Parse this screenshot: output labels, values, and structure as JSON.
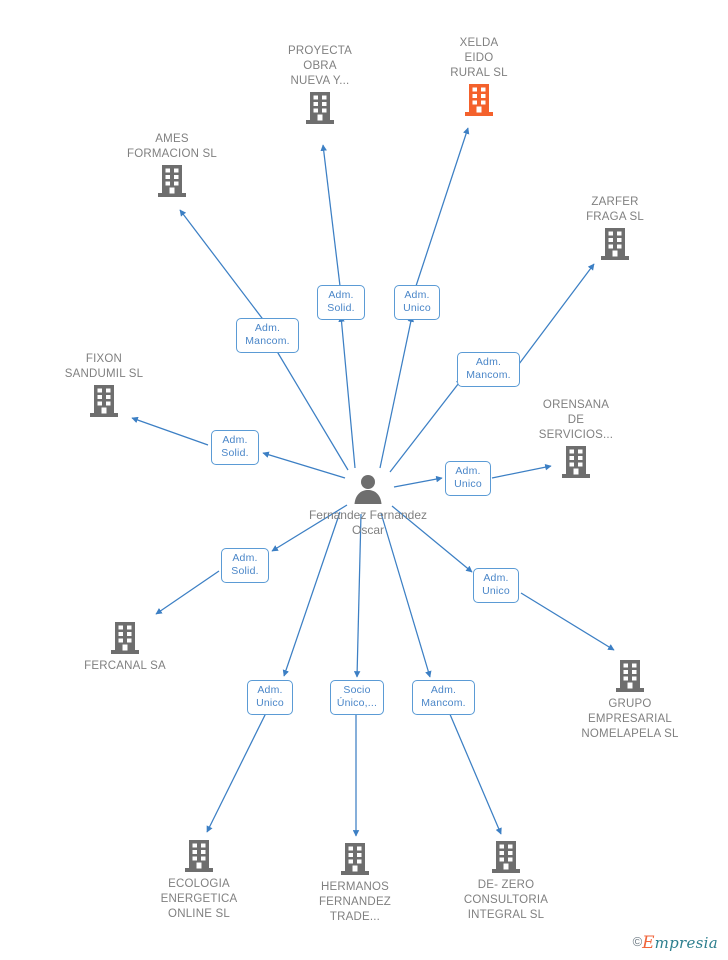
{
  "graph": {
    "center": {
      "name": "Fernandez Fernandez Oscar",
      "icon": "person-icon",
      "color": "#6e6e6e"
    },
    "nodes": [
      {
        "id": "proyecta",
        "label": "PROYECTA\nOBRA\nNUEVA Y...",
        "icon": "building-icon",
        "color": "#6e6e6e",
        "highlighted": false
      },
      {
        "id": "xelda",
        "label": "XELDA\nEIDO\nRURAL SL",
        "icon": "building-icon",
        "color": "#f4612c",
        "highlighted": true
      },
      {
        "id": "ames",
        "label": "AMES\nFORMACION SL",
        "icon": "building-icon",
        "color": "#6e6e6e",
        "highlighted": false
      },
      {
        "id": "zarfer",
        "label": "ZARFER\nFRAGA SL",
        "icon": "building-icon",
        "color": "#6e6e6e",
        "highlighted": false
      },
      {
        "id": "fixon",
        "label": "FIXON\nSANDUMIL SL",
        "icon": "building-icon",
        "color": "#6e6e6e",
        "highlighted": false
      },
      {
        "id": "orensana",
        "label": "ORENSANA\nDE\nSERVICIOS...",
        "icon": "building-icon",
        "color": "#6e6e6e",
        "highlighted": false
      },
      {
        "id": "fercanal",
        "label": "FERCANAL SA",
        "icon": "building-icon",
        "color": "#6e6e6e",
        "highlighted": false
      },
      {
        "id": "grupo",
        "label": "GRUPO\nEMPRESARIAL\nNOMELAPELA SL",
        "icon": "building-icon",
        "color": "#6e6e6e",
        "highlighted": false
      },
      {
        "id": "ecologia",
        "label": "ECOLOGIA\nENERGETICA\nONLINE SL",
        "icon": "building-icon",
        "color": "#6e6e6e",
        "highlighted": false
      },
      {
        "id": "hermanos",
        "label": "HERMANOS\nFERNANDEZ\nTRADE...",
        "icon": "building-icon",
        "color": "#6e6e6e",
        "highlighted": false
      },
      {
        "id": "dezero",
        "label": "DE- ZERO\nCONSULTORIA\nINTEGRAL SL",
        "icon": "building-icon",
        "color": "#6e6e6e",
        "highlighted": false
      }
    ],
    "edge_labels": [
      {
        "id": "e-ames",
        "text": "Adm.\nMancom.",
        "target": "ames"
      },
      {
        "id": "e-proyecta",
        "text": "Adm.\nSolid.",
        "target": "proyecta"
      },
      {
        "id": "e-xelda",
        "text": "Adm.\nUnico",
        "target": "xelda"
      },
      {
        "id": "e-zarfer",
        "text": "Adm.\nMancom.",
        "target": "zarfer"
      },
      {
        "id": "e-fixon",
        "text": "Adm.\nSolid.",
        "target": "fixon"
      },
      {
        "id": "e-orensana",
        "text": "Adm.\nUnico",
        "target": "orensana"
      },
      {
        "id": "e-fercanal",
        "text": "Adm.\nSolid.",
        "target": "fercanal"
      },
      {
        "id": "e-grupo",
        "text": "Adm.\nUnico",
        "target": "grupo"
      },
      {
        "id": "e-ecologia",
        "text": "Adm.\nUnico",
        "target": "ecologia"
      },
      {
        "id": "e-hermanos",
        "text": "Socio\nÚnico,...",
        "target": "hermanos"
      },
      {
        "id": "e-dezero",
        "text": "Adm.\nMancom.",
        "target": "dezero"
      }
    ],
    "edge_color": "#3c7fc4"
  },
  "watermark": {
    "copyright": "©",
    "brand_first": "E",
    "brand_rest": "mpresia"
  }
}
